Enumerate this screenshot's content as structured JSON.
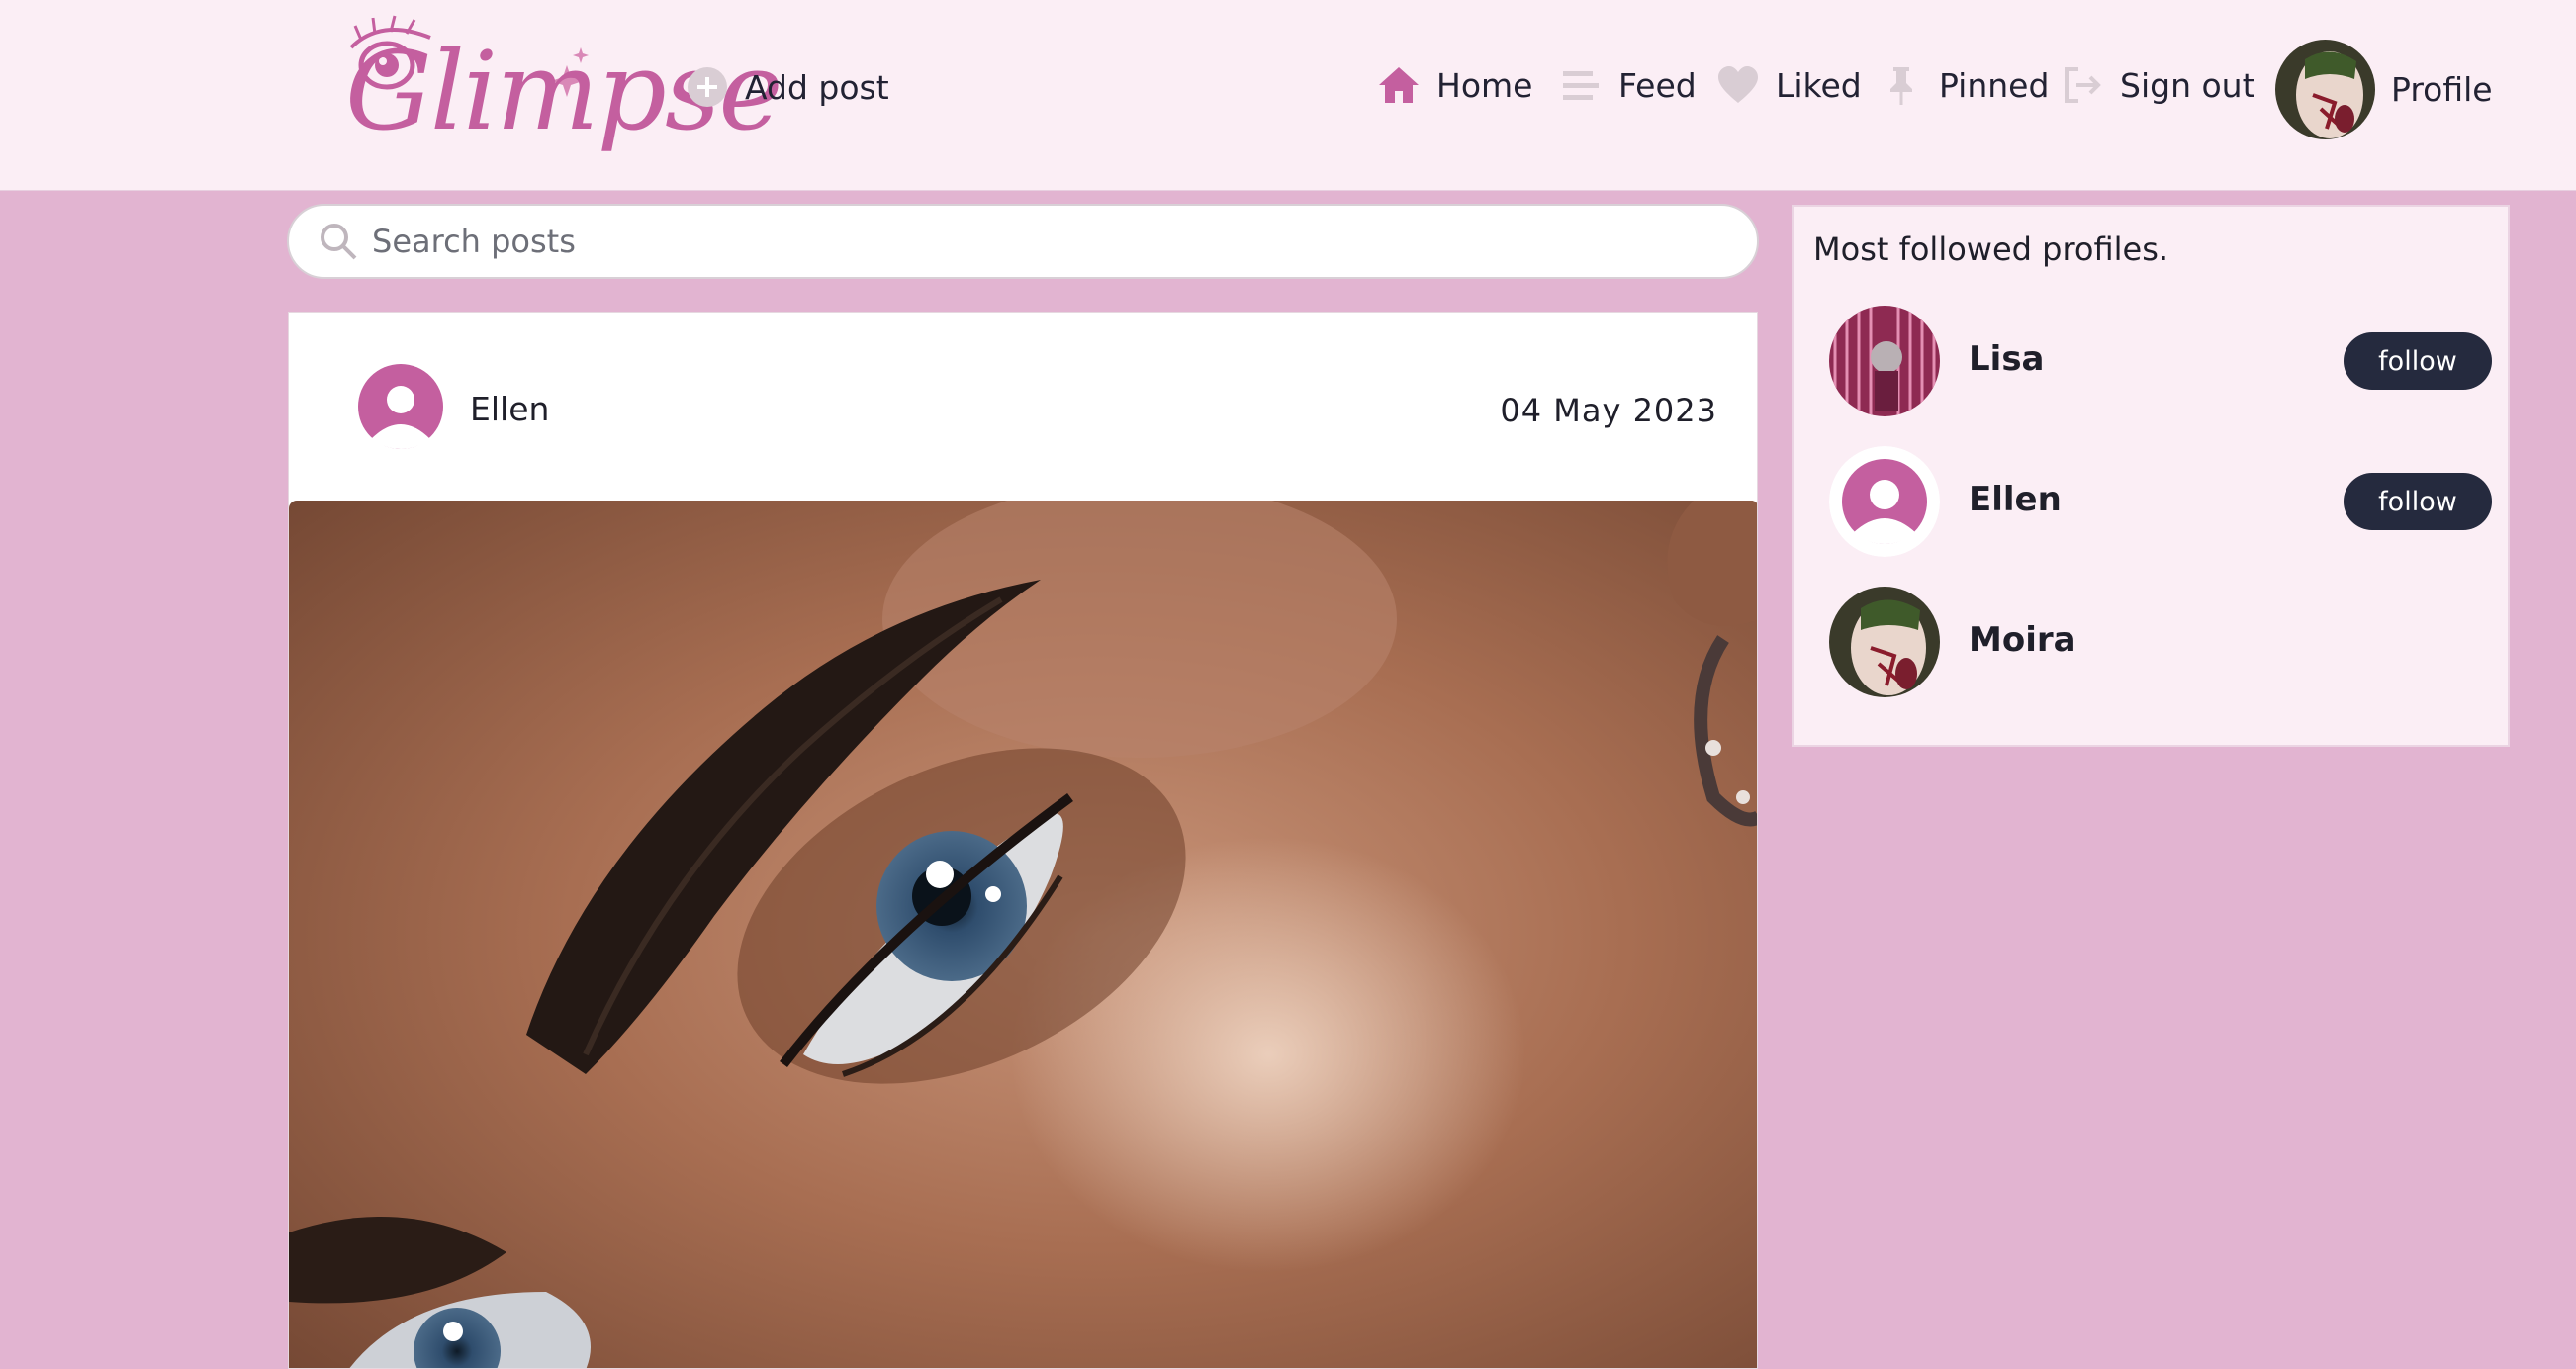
{
  "brand": {
    "logo_text": "Glimpse",
    "accent_color": "#c45f9f"
  },
  "nav": {
    "add_post": "Add post",
    "home": "Home",
    "feed": "Feed",
    "liked": "Liked",
    "pinned": "Pinned",
    "sign_out": "Sign out",
    "profile": "Profile"
  },
  "search": {
    "placeholder": "Search posts",
    "value": ""
  },
  "post": {
    "author": "Ellen",
    "date": "04 May 2023",
    "image_subject": "close-up eye makeup photo"
  },
  "sidebar": {
    "title": "Most followed profiles.",
    "profiles": [
      {
        "name": "Lisa",
        "button": "follow"
      },
      {
        "name": "Ellen",
        "button": "follow"
      },
      {
        "name": "Moira",
        "button": ""
      }
    ]
  },
  "colors": {
    "page_bg": "#e2b4d1",
    "header_bg": "#fbeef5",
    "button_bg": "#252a3e",
    "icon_pink": "#c45f9f"
  }
}
